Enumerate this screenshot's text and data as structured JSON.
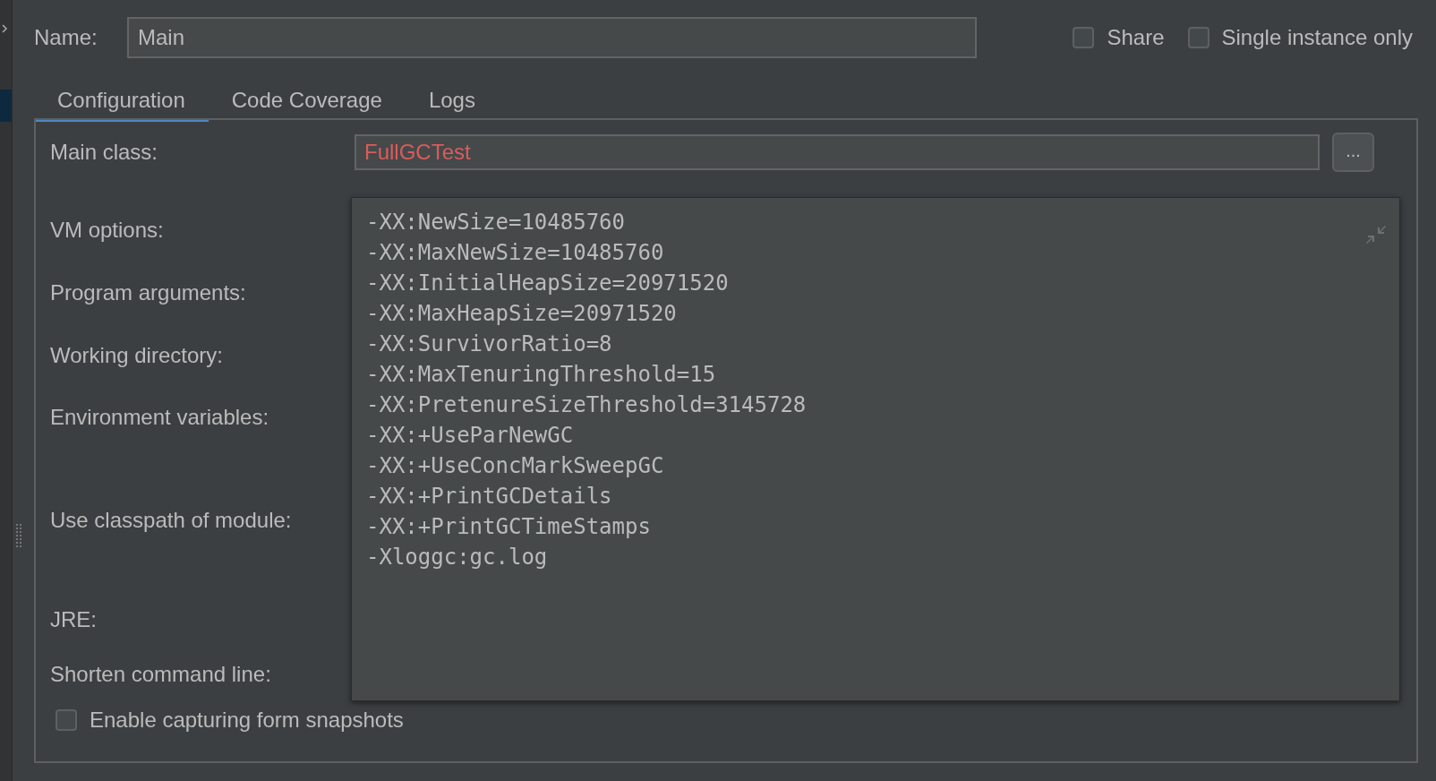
{
  "name_field": {
    "label": "Name:",
    "value": "Main"
  },
  "options": [
    {
      "label": "Share",
      "checked": false
    },
    {
      "label": "Single instance only",
      "checked": false
    }
  ],
  "tabs": [
    {
      "label": "Configuration",
      "selected": true
    },
    {
      "label": "Code Coverage",
      "selected": false
    },
    {
      "label": "Logs",
      "selected": false
    }
  ],
  "main_class": {
    "label": "Main class:",
    "value": "FullGCTest",
    "invalid": true,
    "browse": "..."
  },
  "labels": [
    "VM options:",
    "Program arguments:",
    "Working directory:",
    "Environment variables:",
    "Use classpath of module:",
    "JRE:",
    "Shorten command line:"
  ],
  "vm_options": [
    "-XX:NewSize=10485760",
    "-XX:MaxNewSize=10485760",
    "-XX:InitialHeapSize=20971520",
    "-XX:MaxHeapSize=20971520",
    "-XX:SurvivorRatio=8",
    "-XX:MaxTenuringThreshold=15",
    "-XX:PretenureSizeThreshold=3145728",
    "-XX:+UseParNewGC",
    "-XX:+UseConcMarkSweepGC",
    "-XX:+PrintGCDetails",
    "-XX:+PrintGCTimeStamps",
    "-Xloggc:gc.log"
  ],
  "snapshot_option": {
    "label": "Enable capturing form snapshots",
    "checked": false
  }
}
